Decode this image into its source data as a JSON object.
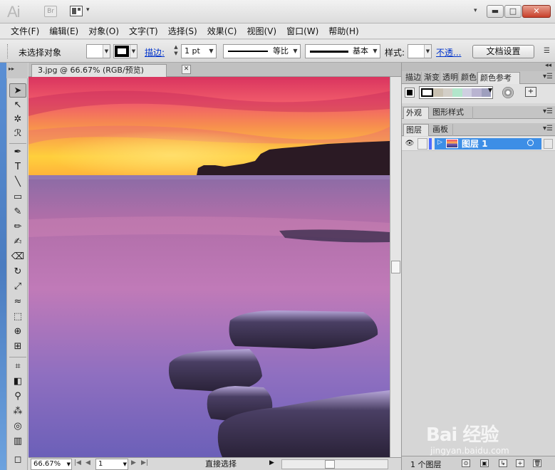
{
  "titlebar": {
    "app_logo": "Ai",
    "bridge_logo": "Br",
    "workspace_arrow": "▾",
    "options_arrow": "▾",
    "minimize": "▬",
    "maximize": "□",
    "close": "✕"
  },
  "menu": [
    "文件(F)",
    "编辑(E)",
    "对象(O)",
    "文字(T)",
    "选择(S)",
    "效果(C)",
    "视图(V)",
    "窗口(W)",
    "帮助(H)"
  ],
  "control": {
    "selection_status": "未选择对象",
    "stroke_label": "描边:",
    "stroke_weight": "1 pt",
    "profile_label": "等比",
    "brush_label": "基本",
    "style_label": "样式:",
    "opacity_link": "不透...",
    "doc_setup_button": "文档设置"
  },
  "document": {
    "tab_title": "3.jpg @ 66.67% (RGB/预览)",
    "tab_close": "✕"
  },
  "statusbar": {
    "zoom": "66.67%",
    "artboard": "1",
    "current_tool": "直接选择"
  },
  "panels": {
    "top_tabs": [
      "描边",
      "渐变",
      "透明",
      "颜色",
      "颜色参考"
    ],
    "appearance_tabs": [
      "外观",
      "图形样式"
    ],
    "layers_tabs": [
      "图层",
      "画板"
    ],
    "layer_name": "图层 1",
    "layers_count": "1 个图层",
    "guide_colors": [
      "#c9c1b2",
      "#d3cfc8",
      "#b2e6cb",
      "#cfcfe1",
      "#b9b4d1",
      "#9e9fbe"
    ]
  },
  "watermark": {
    "brand": "Bai 经验",
    "url": "jingyan.baidu.com"
  },
  "colors": {
    "selection": "#3d8ee6",
    "link": "#0033cc",
    "close_button": "#c8402b"
  }
}
